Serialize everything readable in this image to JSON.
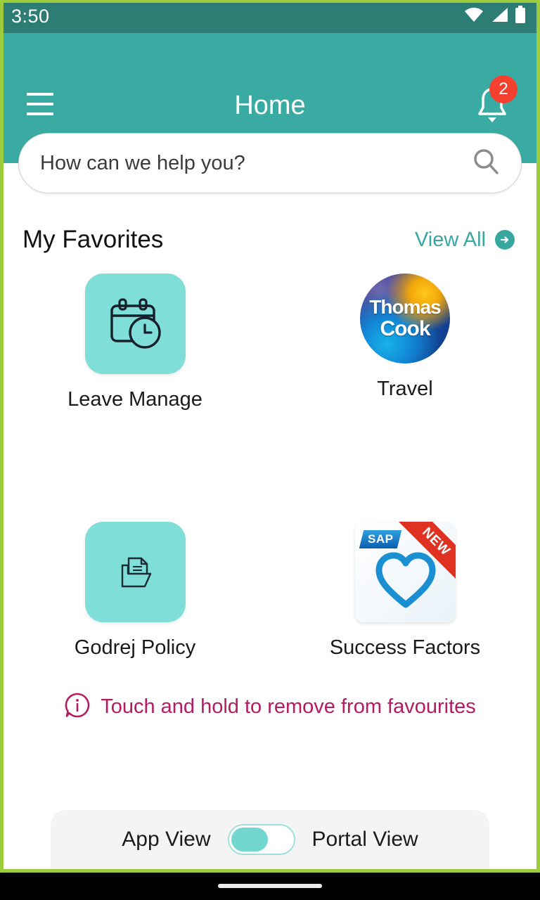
{
  "status_bar": {
    "time": "3:50",
    "icons": [
      "wifi-icon",
      "cellular-signal-icon",
      "battery-icon"
    ]
  },
  "app_bar": {
    "title": "Home",
    "menu_icon": "hamburger-menu-icon",
    "notification_icon": "bell-icon",
    "notification_count": "2"
  },
  "search": {
    "placeholder": "How can we help you?",
    "value": "",
    "icon": "search-icon"
  },
  "favorites": {
    "section_title": "My Favorites",
    "view_all_label": "View All",
    "view_all_icon": "arrow-right-icon",
    "items": [
      {
        "label": "Leave Manage",
        "icon": "calendar-clock-icon",
        "badge": ""
      },
      {
        "label": "Travel",
        "icon": "thomas-cook-logo",
        "logo_line1": "Thomas",
        "logo_line2": "Cook",
        "badge": ""
      },
      {
        "label": "Godrej Policy",
        "icon": "document-folder-icon",
        "badge": ""
      },
      {
        "label": "Success Factors",
        "icon": "sap-successfactors-logo",
        "logo_text": "SAP",
        "badge": "NEW"
      }
    ]
  },
  "hint": {
    "icon": "info-bubble-icon",
    "text": "Touch and hold to remove from favourites"
  },
  "view_switch": {
    "left_label": "App View",
    "right_label": "Portal View",
    "state": "left"
  },
  "colors": {
    "status_bar": "#2d7d74",
    "app_bar": "#3aaba3",
    "accent_teal": "#37a79f",
    "tile_teal": "#7fded8",
    "badge_red": "#f4402e",
    "hint_magenta": "#b41b63",
    "frame_green": "#9ccc3c",
    "ribbon_red": "#e03223",
    "sap_blue": "#0a5fb0"
  }
}
